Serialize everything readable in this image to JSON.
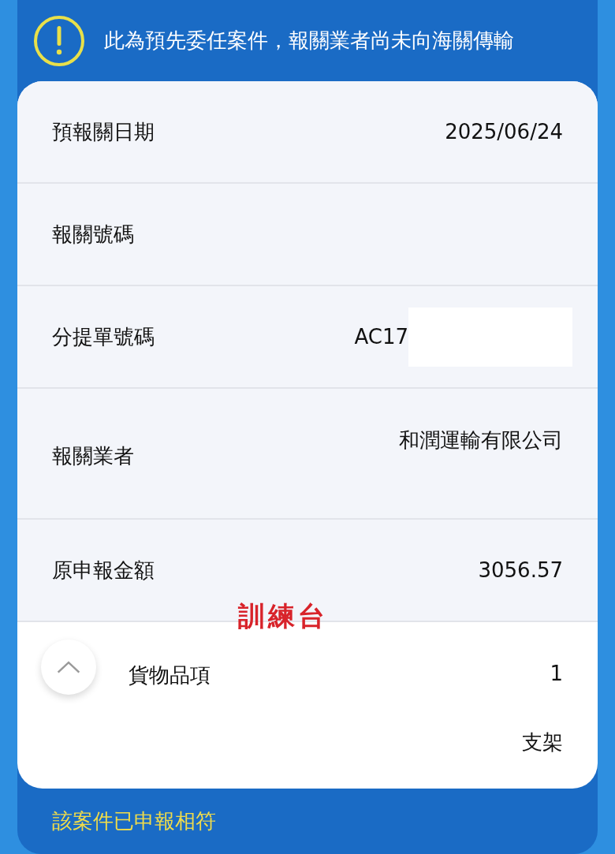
{
  "notice": {
    "text": "此為預先委任案件，報關業者尚未向海關傳輸"
  },
  "rows": [
    {
      "kind": "plain",
      "label": "預報關日期",
      "value": "2025/06/24"
    },
    {
      "kind": "plain",
      "label": "報關號碼"
    },
    {
      "kind": "redacted",
      "label": "分提單號碼",
      "value": "AC17"
    },
    {
      "kind": "tall",
      "label": "報關業者",
      "value": "和潤運輸有限公司"
    },
    {
      "kind": "plain",
      "label": "原申報金額",
      "value": "3056.57"
    }
  ],
  "stamp": "訓練台",
  "goods": {
    "label": "貨物品項",
    "count": "1",
    "item": "支架"
  },
  "footer": {
    "text": "該案件已申報相符"
  }
}
